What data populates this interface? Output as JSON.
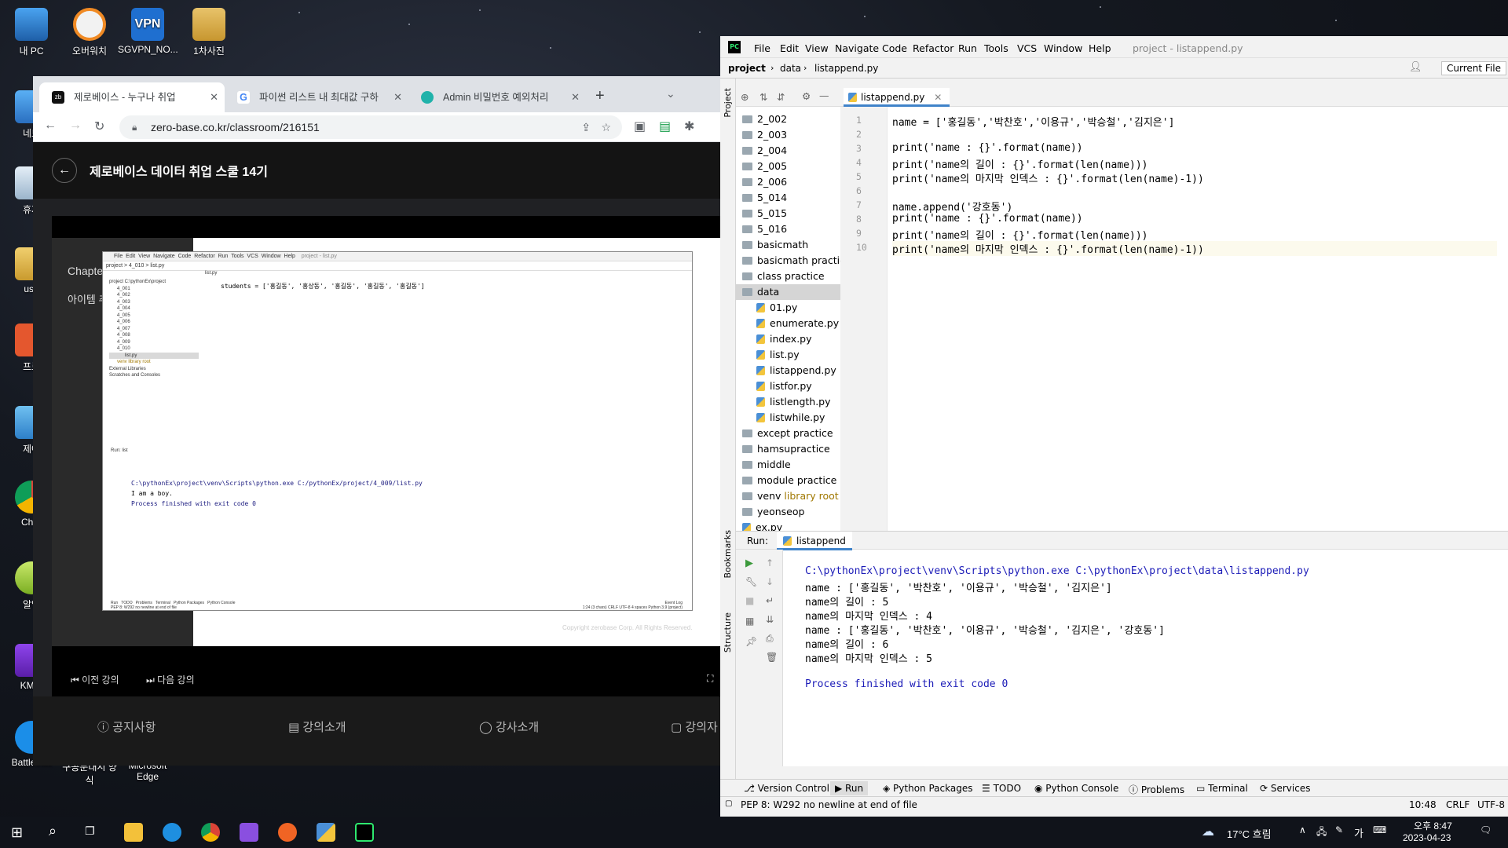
{
  "desktop": {
    "icons": [
      {
        "label": "내 PC"
      },
      {
        "label": "오버워치"
      },
      {
        "label": "SGVPN_NO..."
      },
      {
        "label": "1차사진"
      },
      {
        "label": "네트"
      },
      {
        "label": "휴지"
      },
      {
        "label": "use"
      },
      {
        "label": "프로"
      },
      {
        "label": "제어"
      },
      {
        "label": "Chro"
      },
      {
        "label": "알약"
      },
      {
        "label": "KMPl"
      },
      {
        "label": "Battle.net"
      },
      {
        "label": "구공문대시 양식"
      },
      {
        "label": "Microsoft Edge"
      }
    ]
  },
  "chrome": {
    "tabs": [
      {
        "label": "제로베이스 - 누구나 취업",
        "active": true
      },
      {
        "label": "파이썬 리스트 내 최대값 구하"
      },
      {
        "label": "Admin 비밀번호 예외처리"
      }
    ],
    "new_tab": "+",
    "url": "zero-base.co.kr/classroom/216151",
    "page": {
      "title": "제로베이스 데이터 취업 스쿨 14기",
      "chapter": "Chapter C",
      "item": "아이템 추가",
      "copyright": "Copyright zerobase Corp. All Rights Reserved.",
      "prev": "이전 강의",
      "next": "다음 강의",
      "nav": [
        "공지사항",
        "강의소개",
        "강사소개",
        "강의자"
      ]
    }
  },
  "video_ide": {
    "menus": [
      "File",
      "Edit",
      "View",
      "Navigate",
      "Code",
      "Refactor",
      "Run",
      "Tools",
      "VCS",
      "Window",
      "Help"
    ],
    "title": "project - list.py",
    "nav": "project > 4_010 > list.py",
    "tab": "list.py",
    "tree": [
      "project C:\\pythonEx\\project",
      "4_001",
      "4_002",
      "4_003",
      "4_004",
      "4_005",
      "4_006",
      "4_007",
      "4_008",
      "4_009",
      "4_010",
      "list.py",
      "venv library root",
      "External Libraries",
      "Scratches and Consoles"
    ],
    "code": "students = ['홍길동', '홍상동', '홍길동', '홍길동', '홍길동']",
    "run_tab": "Run:  list",
    "output": [
      "C:\\pythonEx\\project\\venv\\Scripts\\python.exe C:/pythonEx/project/4_009/list.py",
      "I am a boy.",
      "",
      "Process finished with exit code 0"
    ],
    "bottom_tabs": [
      "Run",
      "TODO",
      "Problems",
      "Terminal",
      "Python Packages",
      "Python Console",
      "Event Log"
    ],
    "status_left": "PEP 8: W292 no newline at end of file",
    "status_right": "1:24 (3 chars)  CRLF  UTF-8  4 spaces  Python 3.9 (project)"
  },
  "pycharm": {
    "logo": "PC",
    "menus": [
      "File",
      "Edit",
      "View",
      "Navigate",
      "Code",
      "Refactor",
      "Run",
      "Tools",
      "VCS",
      "Window",
      "Help"
    ],
    "window_title": "project - listappend.py",
    "breadcrumb": [
      "project",
      "data",
      "listappend.py"
    ],
    "current_file": "Current File",
    "side_labels": {
      "project": "Project",
      "bookmarks": "Bookmarks",
      "structure": "Structure"
    },
    "tree": [
      {
        "name": "2_002",
        "type": "folder",
        "indent": 0
      },
      {
        "name": "2_003",
        "type": "folder",
        "indent": 0
      },
      {
        "name": "2_004",
        "type": "folder",
        "indent": 0
      },
      {
        "name": "2_005",
        "type": "folder",
        "indent": 0
      },
      {
        "name": "2_006",
        "type": "folder",
        "indent": 0
      },
      {
        "name": "5_014",
        "type": "folder",
        "indent": 0
      },
      {
        "name": "5_015",
        "type": "folder",
        "indent": 0
      },
      {
        "name": "5_016",
        "type": "folder",
        "indent": 0
      },
      {
        "name": "basicmath",
        "type": "folder",
        "indent": 0
      },
      {
        "name": "basicmath practice",
        "type": "folder",
        "indent": 0
      },
      {
        "name": "class practice",
        "type": "folder",
        "indent": 0
      },
      {
        "name": "data",
        "type": "folder",
        "indent": 0,
        "selected": true
      },
      {
        "name": "01.py",
        "type": "py",
        "indent": 1
      },
      {
        "name": "enumerate.py",
        "type": "py",
        "indent": 1
      },
      {
        "name": "index.py",
        "type": "py",
        "indent": 1
      },
      {
        "name": "list.py",
        "type": "py",
        "indent": 1
      },
      {
        "name": "listappend.py",
        "type": "py",
        "indent": 1
      },
      {
        "name": "listfor.py",
        "type": "py",
        "indent": 1
      },
      {
        "name": "listlength.py",
        "type": "py",
        "indent": 1
      },
      {
        "name": "listwhile.py",
        "type": "py",
        "indent": 1
      },
      {
        "name": "except practice",
        "type": "folder",
        "indent": 0
      },
      {
        "name": "hamsupractice",
        "type": "folder",
        "indent": 0
      },
      {
        "name": "middle",
        "type": "folder",
        "indent": 0
      },
      {
        "name": "module practice",
        "type": "folder",
        "indent": 0
      },
      {
        "name": "venv",
        "type": "folder",
        "indent": 0,
        "note": "library root"
      },
      {
        "name": "yeonseop",
        "type": "folder",
        "indent": 0
      },
      {
        "name": "ex.py",
        "type": "py",
        "indent": 0
      }
    ],
    "editor_tab": "listappend.py",
    "code_lines": [
      "name = ['홍길동','박찬호','이용규','박승철','김지은']",
      "",
      "print('name : {}'.format(name))",
      "print('name의 길이 : {}'.format(len(name)))",
      "print('name의 마지막 인덱스 : {}'.format(len(name)-1))",
      "",
      "name.append('강호동')",
      "print('name : {}'.format(name))",
      "print('name의 길이 : {}'.format(len(name)))",
      "print('name의 마지막 인덱스 : {}'.format(len(name)-1))"
    ],
    "run_label": "Run:",
    "run_tab": "listappend",
    "output_lines": [
      "C:\\pythonEx\\project\\venv\\Scripts\\python.exe C:\\pythonEx\\project\\data\\listappend.py",
      "name : ['홍길동', '박찬호', '이용규', '박승철', '김지은']",
      "name의 길이 : 5",
      "name의 마지막 인덱스 : 4",
      "name : ['홍길동', '박찬호', '이용규', '박승철', '김지은', '강호동']",
      "name의 길이 : 6",
      "name의 마지막 인덱스 : 5",
      "",
      "Process finished with exit code 0"
    ],
    "bottom_tabs": [
      "Version Control",
      "Run",
      "Python Packages",
      "TODO",
      "Python Console",
      "Problems",
      "Terminal",
      "Services"
    ],
    "status_left": "PEP 8: W292 no newline at end of file",
    "status_right": [
      "10:48",
      "CRLF",
      "UTF-8"
    ]
  },
  "taskbar": {
    "weather": "17°C 흐림",
    "time": "오후 8:47",
    "date": "2023-04-23",
    "ime": "가"
  }
}
